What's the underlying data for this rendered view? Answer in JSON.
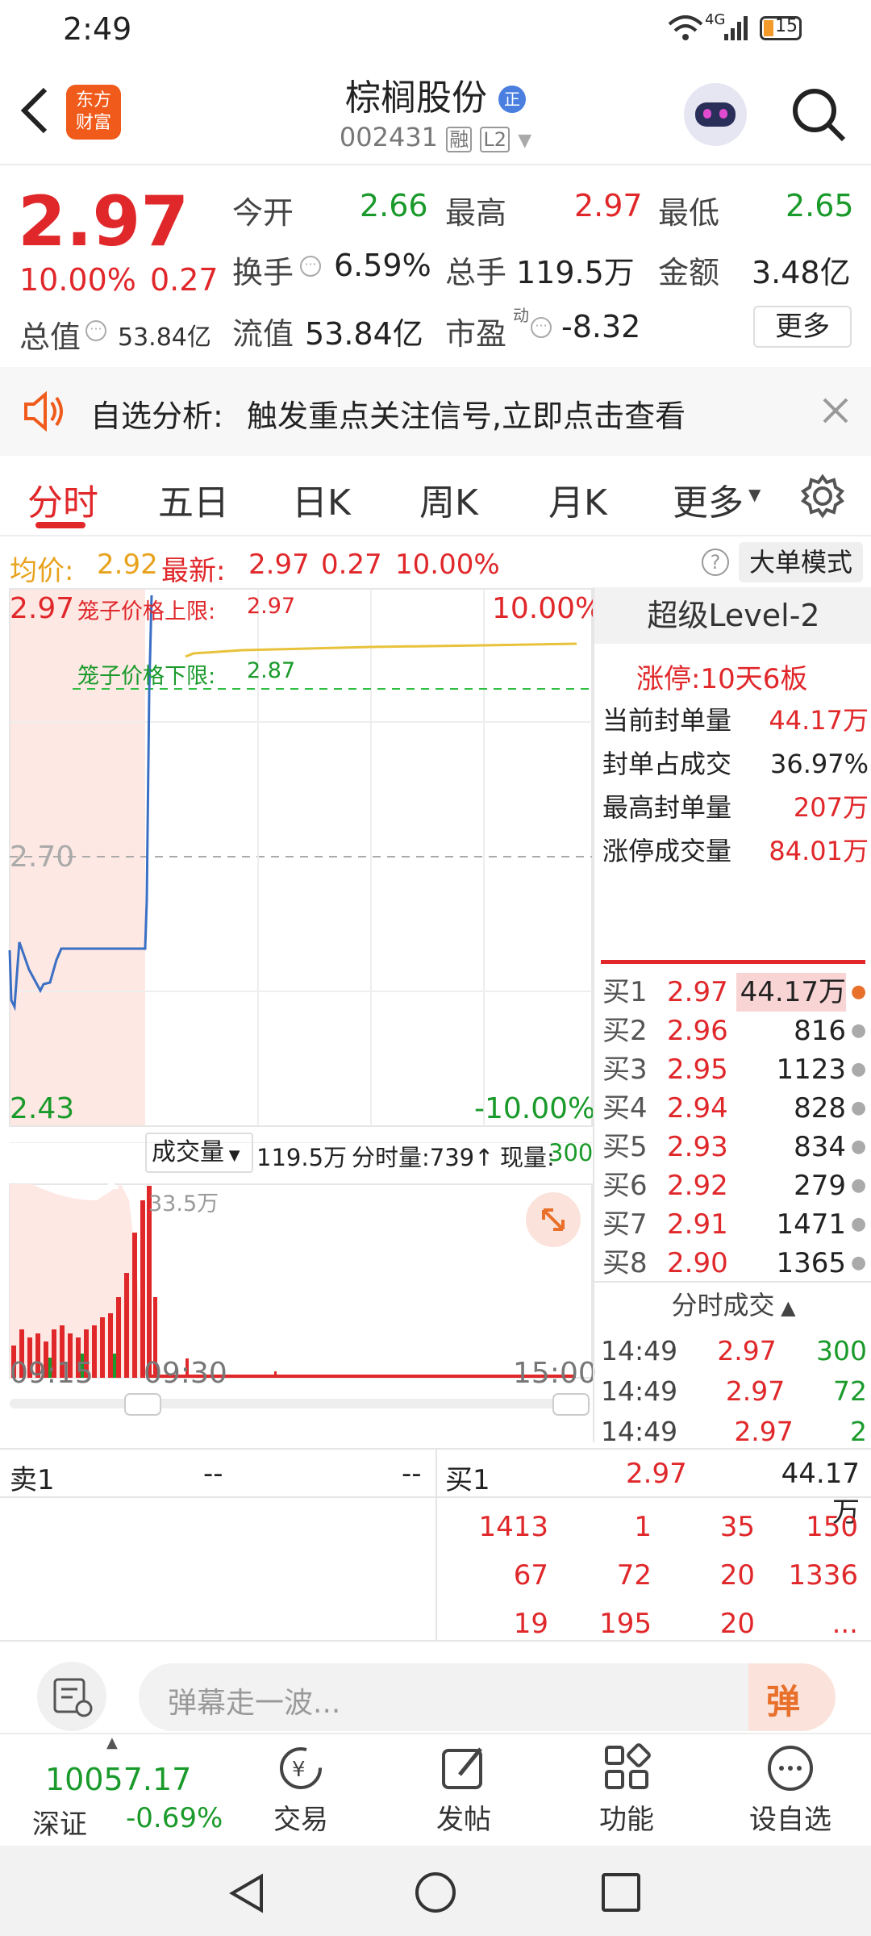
{
  "status": {
    "time": "2:49",
    "net": "4G",
    "battery": "15"
  },
  "header": {
    "brand_line1": "东方",
    "brand_line2": "财富",
    "name": "棕榈股份",
    "name_badge": "正",
    "code": "002431",
    "tag_rong": "融",
    "tag_l2": "L2"
  },
  "quote": {
    "price": "2.97",
    "pct": "10.00%",
    "chg": "0.27",
    "open_label": "今开",
    "open": "2.66",
    "high_label": "最高",
    "high": "2.97",
    "low_label": "最低",
    "low": "2.65",
    "turnover_label": "换手",
    "turnover": "6.59%",
    "vol_label": "总手",
    "vol": "119.5万",
    "amount_label": "金额",
    "amount": "3.48亿",
    "mcap_label": "总值",
    "mcap": "53.84亿",
    "float_label": "流值",
    "float": "53.84亿",
    "pe_label": "市盈",
    "pe_sup": "动",
    "pe": "-8.32",
    "more": "更多"
  },
  "alert": {
    "label": "自选分析:",
    "text": "触发重点关注信号,立即点击查看"
  },
  "tabs": [
    "分时",
    "五日",
    "日K",
    "周K",
    "月K",
    "更多"
  ],
  "avgbar": {
    "avg_label": "均价:",
    "avg": "2.92",
    "last_label": "最新:",
    "last": "2.97",
    "chg": "0.27",
    "pct": "10.00%",
    "mode": "大单模式"
  },
  "chart": {
    "upper_label": "笼子价格上限:",
    "upper": "2.97",
    "lower_label": "笼子价格下限:",
    "lower": "2.87",
    "y_top": "2.97",
    "y_mid": "2.70",
    "y_bot": "2.43",
    "pct_top": "10.00%",
    "pct_bot": "-10.00%",
    "vol_label": "成交量",
    "vol_total": "119.5万",
    "vol_min": "分时量:739↑",
    "vol_now_label": "现量:",
    "vol_now": "300",
    "vol_max": "33.5万",
    "t_start": "09:15",
    "t_mid": "09:30",
    "t_end": "15:00"
  },
  "chart_data": {
    "type": "line",
    "x_ticks": [
      "09:15",
      "09:30",
      "15:00"
    ],
    "ylim": [
      2.43,
      2.97
    ],
    "series": [
      {
        "name": "",
        "values": [
          2.7,
          2.66,
          2.66,
          2.66,
          2.66,
          2.97,
          2.97,
          2.97
        ]
      }
    ]
  },
  "side": {
    "title": "超级Level-2",
    "limit": "涨停:10天6板",
    "rows": [
      {
        "k": "当前封单量",
        "v": "44.17万"
      },
      {
        "k": "封单占成交",
        "v": "36.97%"
      },
      {
        "k": "最高封单量",
        "v": "207万"
      },
      {
        "k": "涨停成交量",
        "v": "84.01万"
      }
    ],
    "bids": [
      {
        "k": "买1",
        "p": "2.97",
        "v": "44.17万"
      },
      {
        "k": "买2",
        "p": "2.96",
        "v": "816"
      },
      {
        "k": "买3",
        "p": "2.95",
        "v": "1123"
      },
      {
        "k": "买4",
        "p": "2.94",
        "v": "828"
      },
      {
        "k": "买5",
        "p": "2.93",
        "v": "834"
      },
      {
        "k": "买6",
        "p": "2.92",
        "v": "279"
      },
      {
        "k": "买7",
        "p": "2.91",
        "v": "1471"
      },
      {
        "k": "买8",
        "p": "2.90",
        "v": "1365"
      }
    ],
    "ticks_title": "分时成交",
    "ticks": [
      {
        "t": "14:49",
        "p": "2.97",
        "v": "300"
      },
      {
        "t": "14:49",
        "p": "2.97",
        "v": "72"
      },
      {
        "t": "14:49",
        "p": "2.97",
        "v": "2"
      }
    ]
  },
  "book": {
    "sell_label": "卖1",
    "sell_p": "--",
    "sell_v": "--",
    "buy_label": "买1",
    "buy_p": "2.97",
    "buy_v": "44.17万",
    "orders": [
      [
        "1413",
        "1",
        "35",
        "150"
      ],
      [
        "67",
        "72",
        "20",
        "1336"
      ],
      [
        "19",
        "195",
        "20",
        "..."
      ]
    ]
  },
  "danmu": {
    "placeholder": "弹幕走一波...",
    "btn": "弹"
  },
  "dock": {
    "index_value": "10057.17",
    "index_name": "深证",
    "index_pct": "-0.69%",
    "items": [
      "交易",
      "发帖",
      "功能",
      "设自选"
    ]
  }
}
